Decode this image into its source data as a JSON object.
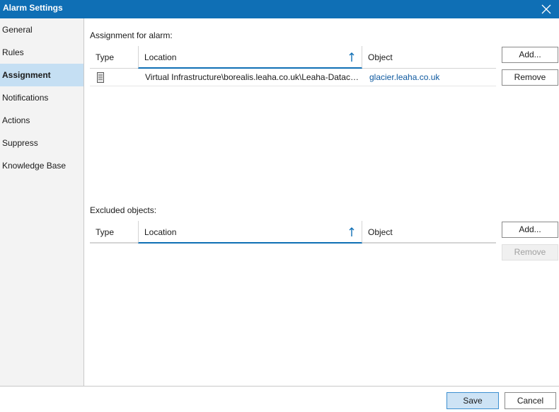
{
  "window": {
    "title": "Alarm Settings"
  },
  "sidebar": {
    "items": [
      {
        "label": "General",
        "active": false
      },
      {
        "label": "Rules",
        "active": false
      },
      {
        "label": "Assignment",
        "active": true
      },
      {
        "label": "Notifications",
        "active": false
      },
      {
        "label": "Actions",
        "active": false
      },
      {
        "label": "Suppress",
        "active": false
      },
      {
        "label": "Knowledge Base",
        "active": false
      }
    ]
  },
  "assignment": {
    "label": "Assignment for alarm:",
    "columns": {
      "type": "Type",
      "location": "Location",
      "object": "Object"
    },
    "sort_icon": "arrow-up-icon",
    "rows": [
      {
        "type_icon": "server-icon",
        "location": "Virtual Infrastructure\\borealis.leaha.co.uk\\Leaha-Datace...",
        "object": "glacier.leaha.co.uk"
      }
    ],
    "add_label": "Add...",
    "remove_label": "Remove"
  },
  "excluded": {
    "label": "Excluded objects:",
    "columns": {
      "type": "Type",
      "location": "Location",
      "object": "Object"
    },
    "sort_icon": "arrow-up-icon",
    "rows": [],
    "add_label": "Add...",
    "remove_label": "Remove",
    "remove_disabled": true
  },
  "footer": {
    "save_label": "Save",
    "cancel_label": "Cancel"
  },
  "colors": {
    "accent": "#0f6fb5",
    "nav_active": "#c5dff3",
    "link": "#0f5aa0"
  }
}
